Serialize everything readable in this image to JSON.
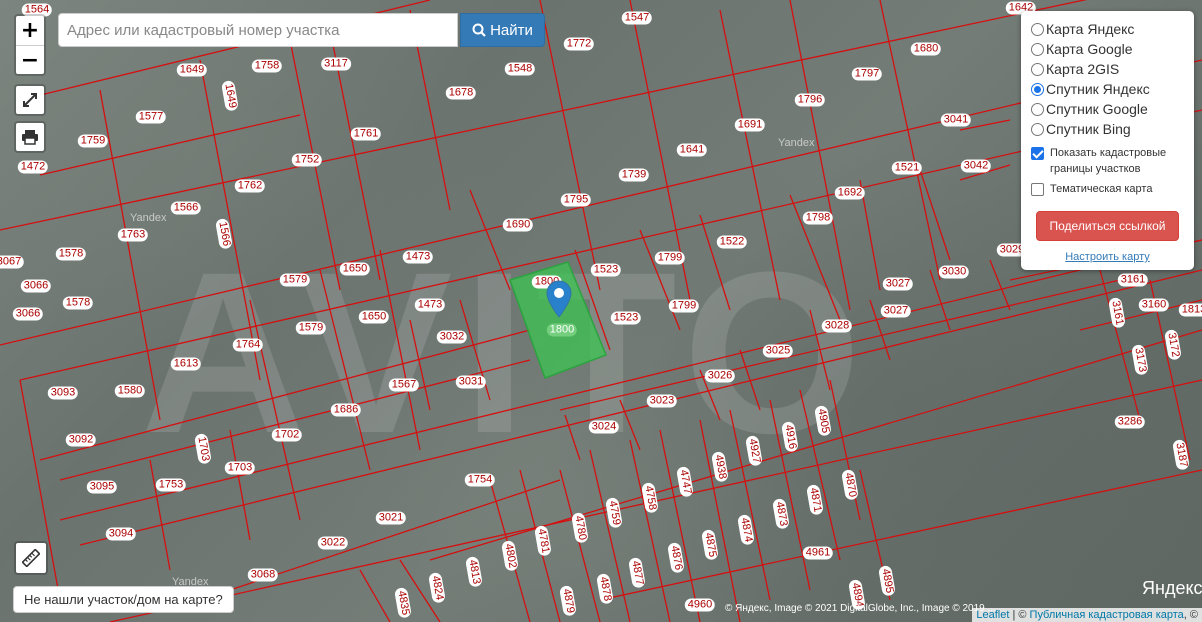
{
  "search": {
    "placeholder": "Адрес или кадастровый номер участка",
    "button_label": "Найти"
  },
  "zoom": {
    "in_label": "+",
    "out_label": "−"
  },
  "layers": {
    "options": [
      "Карта Яндекс",
      "Карта Google",
      "Карта 2GIS",
      "Спутник Яндекс",
      "Спутник Google",
      "Спутник Bing"
    ],
    "selected": "Спутник Яндекс",
    "show_boundaries_label": "Показать кадастровые границы участков",
    "show_boundaries_checked": true,
    "thematic_label": "Тематическая карта",
    "thematic_checked": false,
    "share_label": "Поделиться ссылкой",
    "settings_label": "Настроить карту"
  },
  "not_found_label": "Не нашли участок/дом на карте?",
  "attribution": {
    "leaflet": "Leaflet",
    "sep": " | © ",
    "pkk": "Публичная кадастровая карта",
    "tail": ", ©"
  },
  "map_copyright": "© Яндекс, Image © 2021 DigitalGlobe, Inc., Image © 2019 ...",
  "yandex_logo": "Яндекс",
  "yandex_small": "Yandex",
  "watermark": "AVITO",
  "highlight_parcel": "1800",
  "parcels": [
    "1564",
    "1547",
    "1772",
    "1642",
    "1649",
    "1758",
    "3117",
    "1548",
    "1680",
    "1577",
    "1649",
    "1678",
    "1797",
    "1796",
    "1759",
    "1761",
    "1691",
    "3041",
    "1472",
    "1752",
    "1641",
    "1762",
    "1739",
    "1521",
    "3042",
    "1566",
    "1795",
    "1692",
    "1763",
    "1566",
    "1690",
    "1798",
    "1578",
    "1473",
    "1650",
    "1522",
    "3067",
    "3066",
    "1579",
    "1523",
    "1799",
    "3029",
    "3030",
    "3161",
    "1578",
    "1473",
    "1800",
    "3027",
    "3160",
    "3066",
    "1579",
    "1650",
    "1523",
    "1799",
    "3027",
    "3161",
    "1813",
    "1764",
    "3032",
    "3028",
    "3172",
    "3093",
    "1580",
    "1613",
    "1567",
    "3031",
    "3026",
    "3025",
    "3173",
    "1686",
    "3023",
    "3092",
    "1702",
    "1703",
    "3024",
    "4916",
    "4905",
    "3286",
    "3187",
    "1703",
    "4927",
    "4938",
    "4747",
    "4870",
    "3095",
    "1753",
    "1754",
    "4758",
    "4871",
    "4759",
    "4873",
    "3021",
    "4780",
    "4874",
    "3094",
    "3022",
    "4781",
    "4802",
    "4875",
    "4876",
    "4961",
    "3068",
    "4813",
    "4877",
    "4878",
    "4895",
    "4894",
    "4835",
    "4824",
    "4879",
    "4960"
  ]
}
